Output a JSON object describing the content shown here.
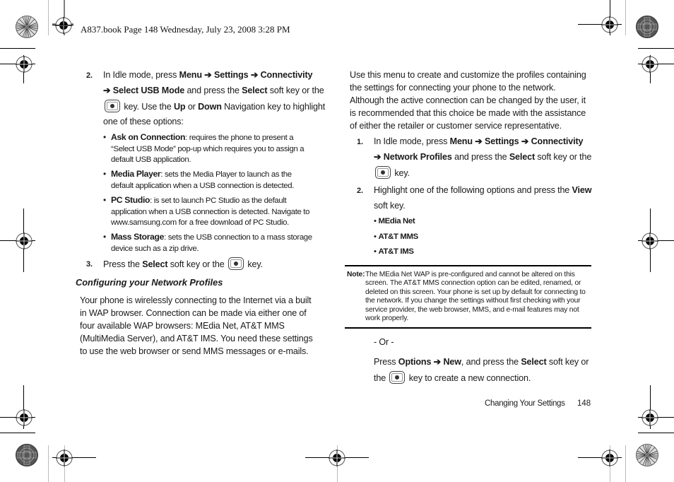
{
  "header": {
    "slug": "A837.book  Page 148  Wednesday, July 23, 2008  3:28 PM"
  },
  "left": {
    "step2": {
      "number": "2.",
      "line1_pre": "In Idle mode, press ",
      "menu": "Menu",
      "arrow": " ➔ ",
      "settings": "Settings",
      "connectivity": "Connectivity",
      "line2_arrow": "➔ ",
      "select_usb_mode": "Select USB Mode",
      "line2_mid": " and press the ",
      "select": "Select",
      "line2_post": " soft key or the",
      "line3_post": " key. Use the ",
      "up": "Up",
      "or": " or ",
      "down": "Down",
      "line3_end": " Navigation key to highlight",
      "line4": "one of these options:"
    },
    "options": [
      {
        "name": "Ask on Connection",
        "desc": ": requires the phone to present a “Select USB Mode” pop-up which requires you to assign a default USB application."
      },
      {
        "name": "Media Player",
        "desc": ": sets the Media Player to launch as the default application when a USB connection is detected."
      },
      {
        "name": "PC Studio",
        "desc": ": is set to launch PC Studio as the default application when a USB connection is detected. Navigate to www.samsung.com for a free download of PC Studio."
      },
      {
        "name": "Mass Storage",
        "desc": ": sets the USB connection to a mass storage device such as a zip drive."
      }
    ],
    "step3": {
      "number": "3.",
      "pre": "Press the ",
      "select": "Select",
      "mid": " soft key or the ",
      "post": " key."
    },
    "section_heading": "Configuring your Network Profiles",
    "section_body": "Your phone is wirelessly connecting to the Internet via a built in WAP browser. Connection can be made via either one of four available WAP browsers: MEdia Net, AT&T MMS (MultiMedia Server), and AT&T IMS. You need these settings to use the web browser or send MMS messages or e-mails."
  },
  "right": {
    "intro": "Use this menu to create and customize the profiles containing the settings for connecting your phone to the network. Although the active connection can be changed by the user, it is recommended that this choice be made with the assistance of either the retailer or customer service representative.",
    "step1": {
      "number": "1.",
      "line1_pre": "In Idle mode, press ",
      "menu": "Menu",
      "arrow": " ➔ ",
      "settings": "Settings",
      "connectivity": "Connectivity",
      "line2_arrow": "➔ ",
      "network_profiles": "Network Profiles",
      "line2_mid": " and press the ",
      "select": "Select",
      "line2_post": " soft key or the",
      "line3_post": " key."
    },
    "step2": {
      "number": "2.",
      "pre": "Highlight one of the following options and press the ",
      "view": "View",
      "line2": "soft key."
    },
    "profiles": [
      "MEdia Net",
      "AT&T MMS",
      "AT&T IMS"
    ],
    "note": {
      "label": "Note:",
      "text": "The MEdia Net WAP is pre-configured and cannot be altered on this screen. The AT&T MMS connection option can be edited, renamed, or deleted on this screen. Your phone is set up by default for connecting to the network. If you change the settings without first checking with your service provider, the web browser, MMS, and e-mail features may not work properly."
    },
    "or": "- Or -",
    "alt": {
      "pre": "Press ",
      "options": "Options",
      "arrow": " ➔ ",
      "new": "New",
      "mid": ", and press the ",
      "select": "Select",
      "post1": " soft key or",
      "the": "the ",
      "post2": " key to create a new connection."
    }
  },
  "footer": {
    "section": "Changing Your Settings",
    "page": "148"
  },
  "icons": {
    "registration_mark": "crosshair-circle",
    "color_wheel": "starburst-circle",
    "gray_patch": "patterned-circle",
    "nav_key": "select-key"
  }
}
